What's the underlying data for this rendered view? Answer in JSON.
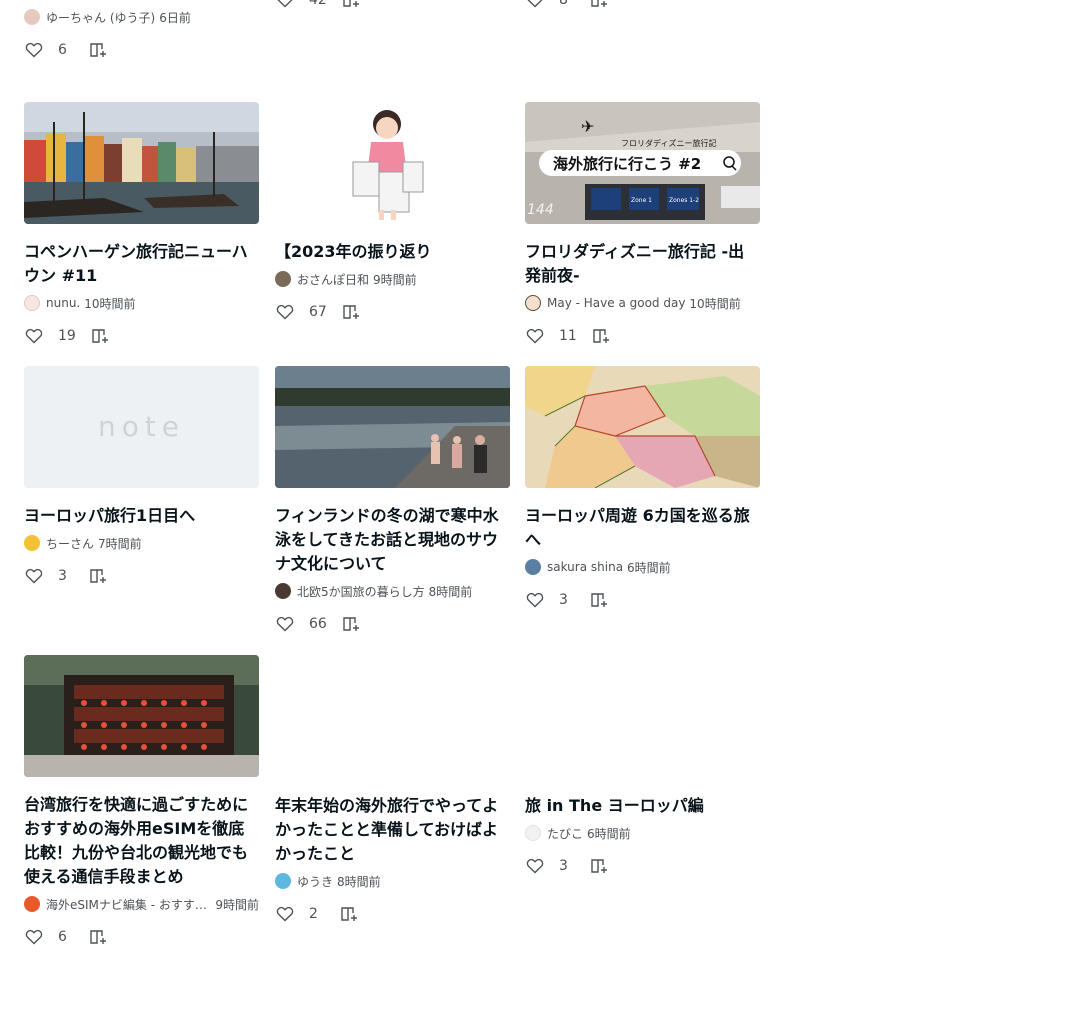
{
  "top_row": [
    {
      "author": "ゆーちゃん (ゆう子)",
      "time": "6日前",
      "likes": "6"
    },
    {
      "likes": "42"
    },
    {
      "likes": "8"
    }
  ],
  "cards": [
    {
      "title": "コペンハーゲン旅行記ニューハウン #11",
      "author": "nunu.",
      "time": "10時間前",
      "likes": "19"
    },
    {
      "title": "【2023年の振り返り",
      "author": "おさんぽ日和",
      "time": "9時間前",
      "likes": "67"
    },
    {
      "title": "フロリダディズニー旅行記 -出発前夜-",
      "author": "May - Have a good day",
      "time": "10時間前",
      "likes": "11"
    },
    {
      "title": "ヨーロッパ旅行1日目へ",
      "author": "ちーさん",
      "time": "7時間前",
      "likes": "3"
    },
    {
      "title": "フィンランドの冬の湖で寒中水泳をしてきたお話と現地のサウナ文化について",
      "author": "北欧5か国旅の暮らし方",
      "time": "8時間前",
      "likes": "66"
    },
    {
      "title": "ヨーロッパ周遊 6カ国を巡る旅へ",
      "author": "sakura shina",
      "time": "6時間前",
      "likes": "3"
    },
    {
      "title": "台湾旅行を快適に過ごすためにおすすめの海外用eSIMを徹底比較！九份や台北の観光地でも使える通信手段まとめ",
      "author": "海外eSIMナビ編集 - おすすめのeSIMを紹介するメディア",
      "time": "9時間前",
      "likes": "6"
    },
    {
      "title": "年末年始の海外旅行でやってよかったことと準備しておけばよかったこと",
      "author": "ゆうき",
      "time": "8時間前",
      "likes": "2"
    },
    {
      "title": "旅 in The ヨーロッパ編",
      "author": "たびこ",
      "time": "6時間前",
      "likes": "3"
    }
  ],
  "thumb_texts": {
    "placeholder_logo": "note",
    "florida_small": "フロリダディズニー旅行記",
    "florida_big": "海外旅行に行こう #2",
    "gate_number": "144",
    "board1": "Zone 1",
    "board2": "Zones 1-2"
  },
  "icons": {
    "like": "heart-icon",
    "save": "magazine-add-icon"
  },
  "colors": {
    "text": "#08131a",
    "sub": "#4d5257",
    "icon": "#4d5257"
  }
}
